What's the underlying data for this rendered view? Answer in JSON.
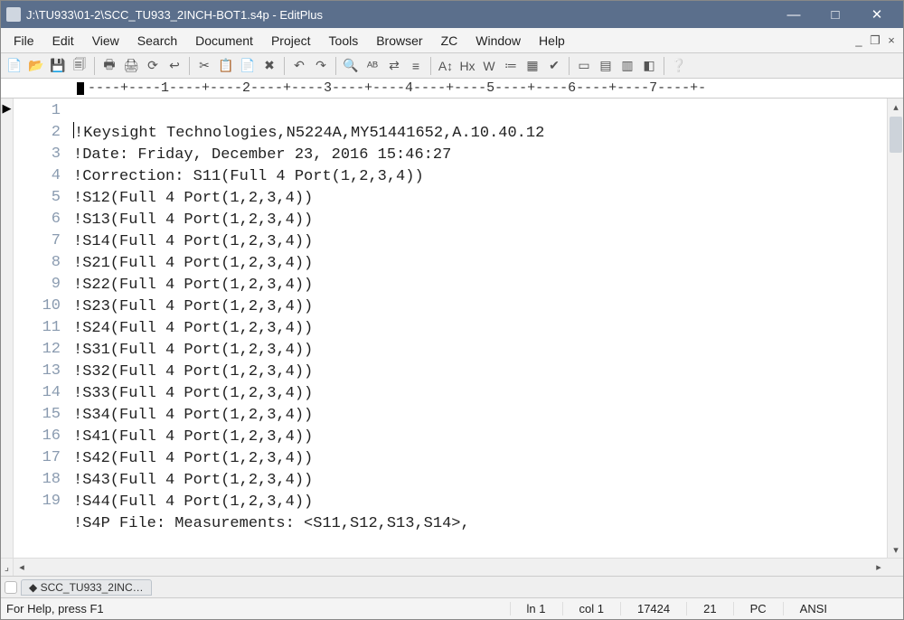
{
  "titlebar": {
    "title": "J:\\TU933\\01-2\\SCC_TU933_2INCH-BOT1.s4p - EditPlus",
    "min": "—",
    "max": "□",
    "close": "✕"
  },
  "menu": {
    "items": [
      "File",
      "Edit",
      "View",
      "Search",
      "Document",
      "Project",
      "Tools",
      "Browser",
      "ZC",
      "Window",
      "Help"
    ],
    "mdi_min": "_",
    "mdi_restore": "❐",
    "mdi_close": "×"
  },
  "toolbar": {
    "icons": [
      "📄",
      "📂",
      "💾",
      "🗐",
      "🖶",
      "🖨",
      "⟳",
      "↩",
      "✂",
      "📋",
      "📄",
      "✖",
      "↶",
      "↷",
      "🔍",
      "ᴬᴮ",
      "⇄",
      "≡",
      "A↕",
      "Hx",
      "W",
      "≔",
      "▦",
      "✔",
      "▭",
      "▤",
      "▥",
      "◧",
      "❔"
    ]
  },
  "ruler": {
    "text": "----+----1----+----2----+----3----+----4----+----5----+----6----+----7----+-"
  },
  "code": {
    "lines": [
      "!Keysight Technologies,N5224A,MY51441652,A.10.40.12",
      "!Date: Friday, December 23, 2016 15:46:27",
      "!Correction: S11(Full 4 Port(1,2,3,4))",
      "!S12(Full 4 Port(1,2,3,4))",
      "!S13(Full 4 Port(1,2,3,4))",
      "!S14(Full 4 Port(1,2,3,4))",
      "!S21(Full 4 Port(1,2,3,4))",
      "!S22(Full 4 Port(1,2,3,4))",
      "!S23(Full 4 Port(1,2,3,4))",
      "!S24(Full 4 Port(1,2,3,4))",
      "!S31(Full 4 Port(1,2,3,4))",
      "!S32(Full 4 Port(1,2,3,4))",
      "!S33(Full 4 Port(1,2,3,4))",
      "!S34(Full 4 Port(1,2,3,4))",
      "!S41(Full 4 Port(1,2,3,4))",
      "!S42(Full 4 Port(1,2,3,4))",
      "!S43(Full 4 Port(1,2,3,4))",
      "!S44(Full 4 Port(1,2,3,4))",
      "!S4P File: Measurements: <S11,S12,S13,S14>,"
    ],
    "numbers": [
      "1",
      "2",
      "3",
      "4",
      "5",
      "6",
      "7",
      "8",
      "9",
      "10",
      "11",
      "12",
      "13",
      "14",
      "15",
      "16",
      "17",
      "18",
      "19"
    ]
  },
  "tabs": {
    "active": "◆ SCC_TU933_2INC…"
  },
  "status": {
    "hint": "For Help, press F1",
    "ln": "ln 1",
    "col": "col 1",
    "total": "17424",
    "lines": "21",
    "os": "PC",
    "enc": "ANSI"
  }
}
